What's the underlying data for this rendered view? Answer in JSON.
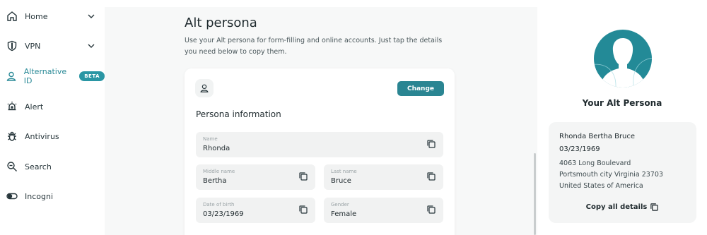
{
  "sidebar": {
    "items": [
      {
        "label": "Home",
        "icon": "home-icon",
        "has_chevron": true
      },
      {
        "label": "VPN",
        "icon": "shield-icon",
        "has_chevron": true
      },
      {
        "label": "Alternative ID",
        "icon": "user-icon",
        "badge": "BETA",
        "active": true
      },
      {
        "label": "Alert",
        "icon": "alert-icon"
      },
      {
        "label": "Antivirus",
        "icon": "bug-icon"
      },
      {
        "label": "Search",
        "icon": "search-icon"
      },
      {
        "label": "Incogni",
        "icon": "toggle-icon"
      }
    ]
  },
  "main": {
    "title": "Alt persona",
    "description": "Use your Alt persona for form-filling and online accounts. Just tap the details you need below to copy them.",
    "change_label": "Change",
    "section_title": "Persona information",
    "fields": {
      "name": {
        "label": "Name",
        "value": "Rhonda"
      },
      "middle_name": {
        "label": "Middle name",
        "value": "Bertha"
      },
      "last_name": {
        "label": "Last name",
        "value": "Bruce"
      },
      "dob": {
        "label": "Date of birth",
        "value": "03/23/1969"
      },
      "gender": {
        "label": "Gender",
        "value": "Female"
      }
    }
  },
  "right": {
    "heading": "Your Alt Persona",
    "full_name": "Rhonda Bertha Bruce",
    "dob": "03/23/1969",
    "address_line1": "4063 Long Boulevard",
    "address_line2": "Portsmouth city Virginia 23703",
    "address_line3": "United States of America",
    "copy_all_label": "Copy all details"
  },
  "colors": {
    "accent": "#2a8592",
    "active_nav": "#2a8a97",
    "avatar_bg": "#238a97"
  }
}
